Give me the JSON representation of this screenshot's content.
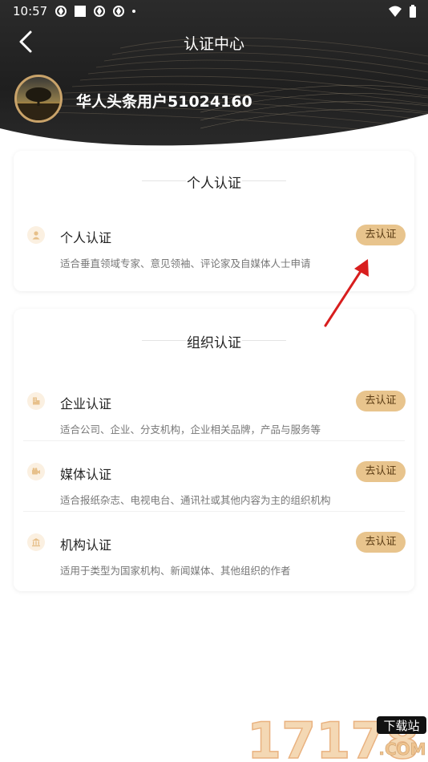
{
  "status_bar": {
    "time": "10:57"
  },
  "header": {
    "title": "认证中心",
    "username": "华人头条用户51024160"
  },
  "sections": [
    {
      "title": "个人认证",
      "items": [
        {
          "title": "个人认证",
          "description": "适合垂直领域专家、意见领袖、评论家及自媒体人士申请",
          "button": "去认证",
          "icon": "person-icon"
        }
      ]
    },
    {
      "title": "组织认证",
      "items": [
        {
          "title": "企业认证",
          "description": "适合公司、企业、分支机构，企业相关品牌，产品与服务等",
          "button": "去认证",
          "icon": "building-icon"
        },
        {
          "title": "媒体认证",
          "description": "适合报纸杂志、电视电台、通讯社或其他内容为主的组织机构",
          "button": "去认证",
          "icon": "camera-icon"
        },
        {
          "title": "机构认证",
          "description": "适用于类型为国家机构、新闻媒体、其他组织的作者",
          "button": "去认证",
          "icon": "institution-icon"
        }
      ]
    }
  ],
  "watermark": {
    "text": "17178",
    "tag": "下载站",
    "suffix": ".COM"
  },
  "colors": {
    "accent": "#e8c48d",
    "accent_text": "#5a3b13",
    "header_bg": "#222222",
    "arrow": "#d81e1e"
  }
}
